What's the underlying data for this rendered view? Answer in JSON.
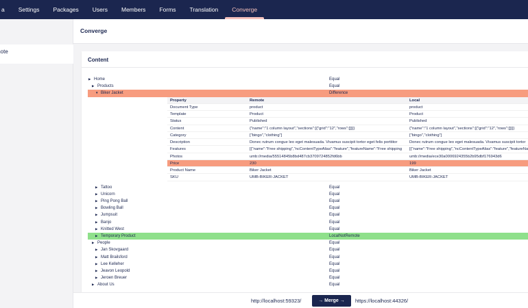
{
  "topnav": {
    "items": [
      "a",
      "Settings",
      "Packages",
      "Users",
      "Members",
      "Forms",
      "Translation",
      "Converge"
    ],
    "active": "Converge"
  },
  "sidebar": {
    "item": "mote"
  },
  "header": {
    "title": "Converge"
  },
  "content": {
    "title": "Content",
    "columns": {
      "property": "Property",
      "remote": "Remote",
      "local": "Local"
    },
    "tree_before": [
      {
        "arrow": "▶",
        "name": "Home",
        "status": "Equal"
      },
      {
        "arrow": "▶",
        "name": "Products",
        "status": "Equal"
      },
      {
        "arrow": "▼",
        "name": "Biker Jacket",
        "status": "Difference"
      }
    ],
    "properties": [
      {
        "property": "Document Type",
        "remote": "product",
        "local": "product"
      },
      {
        "property": "Template",
        "remote": "Product",
        "local": "Product"
      },
      {
        "property": "Status",
        "remote": "Published",
        "local": "Published"
      },
      {
        "property": "Content",
        "remote": "{\"name\":\"1 column layout\",\"sections\":[{\"grid\":\"12\",\"rows\":[]}]}",
        "local": "{\"name\":\"1 column layout\",\"sections\":[{\"grid\":\"12\",\"rows\":[]}]}"
      },
      {
        "property": "Category",
        "remote": "[\"bingo\",\"clothing\"]",
        "local": "[\"bingo\",\"clothing\"]"
      },
      {
        "property": "Description",
        "remote": "Donec rutrum congue leo eget malesuada. Vivamus suscipit tortor eget felis porttitor",
        "local": "Donec rutrum congue leo eget malesuada. Vivamus suscipit tortor"
      },
      {
        "property": "Features",
        "remote": "[{\"name\":\"Free shipping\",\"ncContentTypeAlias\":\"feature\",\"featureName\":\"Free shipping",
        "local": "[{\"name\":\"Free shipping\",\"ncContentTypeAlias\":\"feature\",\"featureName"
      },
      {
        "property": "Photos",
        "remote": "umb://media/55514845b8bd487cb3709724852fd6bb",
        "local": "umb://media/ece30a0006924355b2b95dbf176943d6"
      },
      {
        "property": "Price",
        "remote": "230",
        "local": "199",
        "diff": true
      },
      {
        "property": "Product Name",
        "remote": "Biker Jacket",
        "local": "Biker Jacket"
      },
      {
        "property": "SKU",
        "remote": "UMB-BIKER-JACKET",
        "local": "UMB-BIKER-JACKET"
      }
    ],
    "tree_after": [
      {
        "arrow": "▶",
        "name": "Tattoo",
        "status": "Equal",
        "indent": 2
      },
      {
        "arrow": "▶",
        "name": "Unicorn",
        "status": "Equal",
        "indent": 2
      },
      {
        "arrow": "▶",
        "name": "Ping Pong Ball",
        "status": "Equal",
        "indent": 2
      },
      {
        "arrow": "▶",
        "name": "Bowling Ball",
        "status": "Equal",
        "indent": 2
      },
      {
        "arrow": "▶",
        "name": "Jumpsuit",
        "status": "Equal",
        "indent": 2
      },
      {
        "arrow": "▶",
        "name": "Banjo",
        "status": "Equal",
        "indent": 2
      },
      {
        "arrow": "▶",
        "name": "Knitted West",
        "status": "Equal",
        "indent": 2
      },
      {
        "arrow": "▶",
        "name": "Temporary Product",
        "status": "LocalNotRemote",
        "indent": 2,
        "new": true
      },
      {
        "arrow": "▶",
        "name": "People",
        "status": "Equal",
        "indent": 1
      },
      {
        "arrow": "▶",
        "name": "Jan Skovgaard",
        "status": "Equal",
        "indent": 2
      },
      {
        "arrow": "▶",
        "name": "Matt Brailsford",
        "status": "Equal",
        "indent": 2
      },
      {
        "arrow": "▶",
        "name": "Lee Kelleher",
        "status": "Equal",
        "indent": 2
      },
      {
        "arrow": "▶",
        "name": "Jeavon Leopold",
        "status": "Equal",
        "indent": 2
      },
      {
        "arrow": "▶",
        "name": "Jeroen Breuer",
        "status": "Equal",
        "indent": 2
      },
      {
        "arrow": "▶",
        "name": "About Us",
        "status": "Equal",
        "indent": 1
      }
    ]
  },
  "footer": {
    "remote_url": "http://localhost:59323/",
    "merge_label": "→ Merge →",
    "local_url": "https://localhost:44326/"
  }
}
